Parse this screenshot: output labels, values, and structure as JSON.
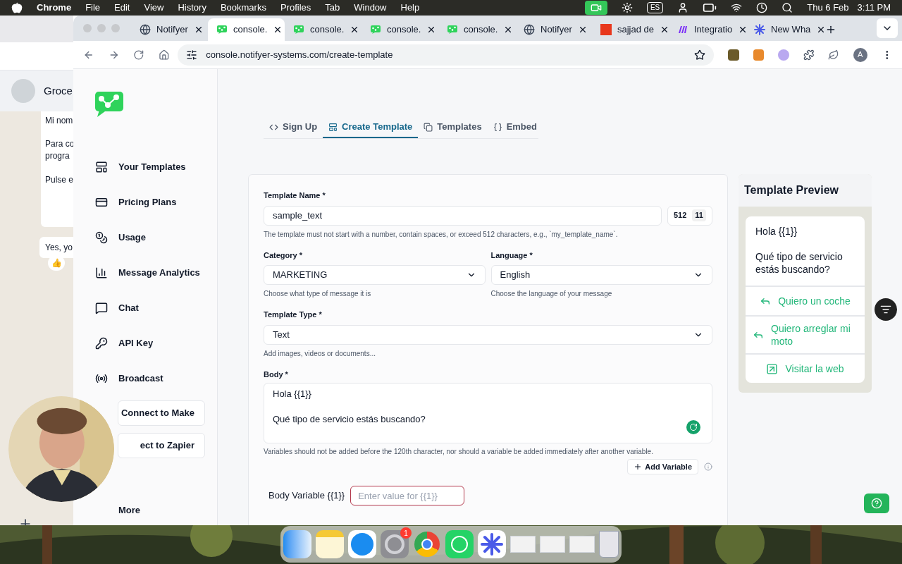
{
  "menu_bar": {
    "app": "Chrome",
    "items": [
      "File",
      "Edit",
      "View",
      "History",
      "Bookmarks",
      "Profiles",
      "Tab",
      "Window",
      "Help"
    ],
    "input_source": "ES",
    "date": "Thu 6 Feb",
    "time": "3:11 PM"
  },
  "browser": {
    "tabs": [
      {
        "title": "Notifyer",
        "kind": "globe",
        "selected": false
      },
      {
        "title": "console.",
        "kind": "app",
        "selected": true
      },
      {
        "title": "console.",
        "kind": "app",
        "selected": false
      },
      {
        "title": "console.",
        "kind": "app",
        "selected": false
      },
      {
        "title": "console.",
        "kind": "app",
        "selected": false
      },
      {
        "title": "Notifyer",
        "kind": "globe",
        "selected": false
      },
      {
        "title": "sajjad de",
        "kind": "square",
        "selected": false
      },
      {
        "title": "Integratio",
        "kind": "make",
        "selected": false
      },
      {
        "title": "New Wha",
        "kind": "star",
        "selected": false
      }
    ],
    "url": "console.notifyer-systems.com/create-template",
    "profile_initial": "A"
  },
  "background_chat": {
    "contact": "Groce",
    "messages": [
      "Mi nom",
      "Para co\nprogra",
      "Pulse e"
    ],
    "reply": "Yes, yo",
    "reaction": "👍"
  },
  "sidebar": {
    "items": [
      {
        "label": "Your Templates",
        "kind": "layout"
      },
      {
        "label": "Pricing Plans",
        "kind": "card"
      },
      {
        "label": "Usage",
        "kind": "coins"
      },
      {
        "label": "Message Analytics",
        "kind": "chart"
      },
      {
        "label": "Chat",
        "kind": "chat"
      },
      {
        "label": "API Key",
        "kind": "key"
      },
      {
        "label": "Broadcast",
        "kind": "broadcast"
      }
    ],
    "buttons": [
      "Connect to Make",
      "ect to Zapier"
    ],
    "more": "More"
  },
  "page_tabs": [
    {
      "label": "Sign Up",
      "kind": "code",
      "selected": false
    },
    {
      "label": "Create Template",
      "kind": "layout",
      "selected": true
    },
    {
      "label": "Templates",
      "kind": "copy",
      "selected": false
    },
    {
      "label": "Embed",
      "kind": "braces",
      "selected": false
    }
  ],
  "form": {
    "template_name": {
      "label": "Template Name *",
      "value": "sample_text",
      "max": "512",
      "count": "11",
      "hint": "The template must not start with a number, contain spaces, or exceed 512 characters, e.g., `my_template_name`."
    },
    "category": {
      "label": "Category *",
      "value": "MARKETING",
      "hint": "Choose what type of message it is"
    },
    "language": {
      "label": "Language *",
      "value": "English",
      "hint": "Choose the language of your message"
    },
    "template_type": {
      "label": "Template Type *",
      "value": "Text",
      "hint": "Add images, videos or documents..."
    },
    "body": {
      "label": "Body *",
      "value": "Hola {{1}}\n\nQué tipo de servicio estás buscando?",
      "hint": "Variables should not be added before the 120th character, nor should a variable be added immediately after another variable."
    },
    "add_variable": "Add Variable",
    "body_variable": {
      "label": "Body Variable {{1}}",
      "placeholder": "Enter value for {{1}}"
    }
  },
  "preview": {
    "title": "Template Preview",
    "greeting": "Hola {{1}}",
    "text": "Qué tipo de servicio estás buscando?",
    "buttons": [
      {
        "label": "Quiero un coche",
        "kind": "reply"
      },
      {
        "label": "Quiero arreglar mi moto",
        "kind": "reply"
      },
      {
        "label": "Visitar la web",
        "kind": "link"
      }
    ]
  },
  "dock": {
    "apps": [
      {
        "kind": "finder"
      },
      {
        "kind": "notes"
      },
      {
        "kind": "safari"
      },
      {
        "kind": "settings",
        "badge": "1"
      },
      {
        "kind": "chrome"
      },
      {
        "kind": "whatsapp"
      },
      {
        "kind": "star"
      },
      {
        "kind": "window"
      },
      {
        "kind": "window"
      },
      {
        "kind": "window"
      },
      {
        "kind": "trash"
      }
    ]
  }
}
